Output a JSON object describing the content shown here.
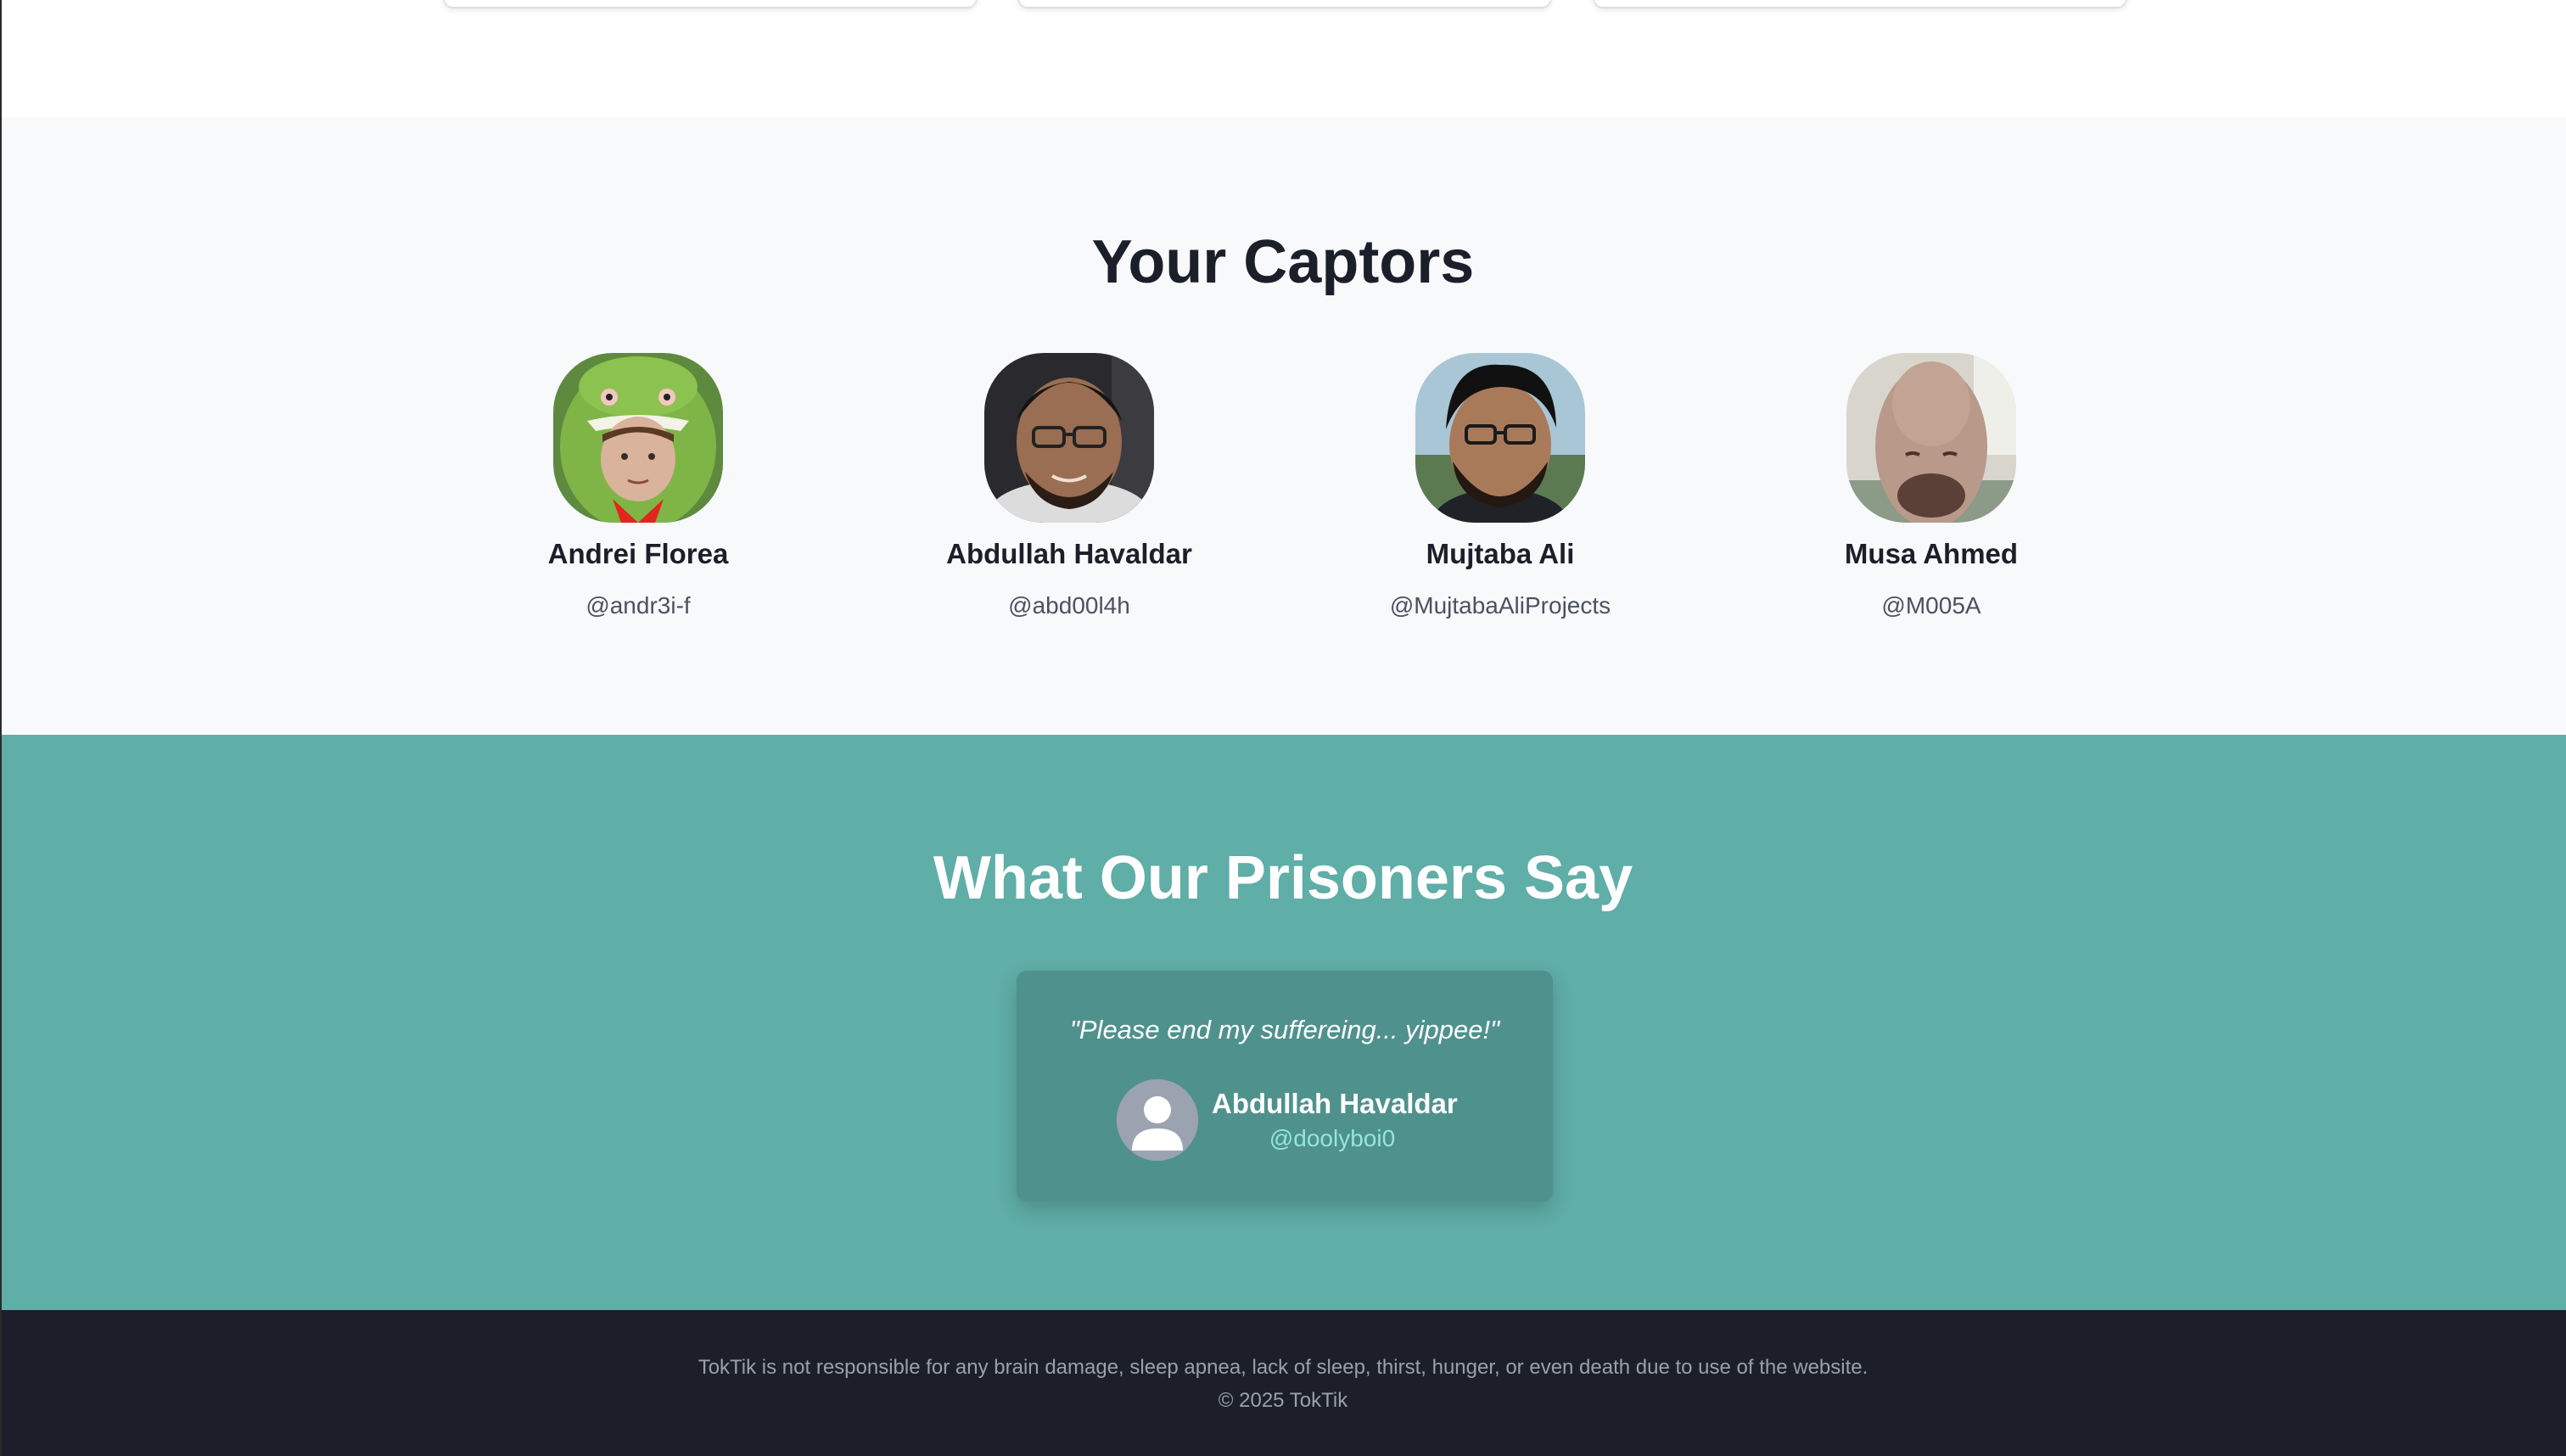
{
  "captors": {
    "title": "Your Captors",
    "people": [
      {
        "name": "Andrei Florea",
        "handle": "@andr3i-f"
      },
      {
        "name": "Abdullah Havaldar",
        "handle": "@abd00l4h"
      },
      {
        "name": "Mujtaba Ali",
        "handle": "@MujtabaAliProjects"
      },
      {
        "name": "Musa Ahmed",
        "handle": "@M005A"
      }
    ]
  },
  "testimonials": {
    "title": "What Our Prisoners Say",
    "items": [
      {
        "quote": "\"Please end my suffereing... yippee!\"",
        "name": "Abdullah Havaldar",
        "handle": "@doolyboi0",
        "avatar_icon": "user-placeholder-icon"
      }
    ]
  },
  "footer": {
    "disclaimer": "TokTik is not responsible for any brain damage, sleep apnea, lack of sleep, thirst, hunger, or even death due to use of the website.",
    "copyright": "© 2025 TokTik"
  },
  "colors": {
    "captors_bg": "#f8f9fb",
    "testimonials_bg": "#5faea7",
    "testimonial_card": "#4f918d",
    "handle_accent": "#93e6da",
    "footer_bg": "#1c1f2a"
  }
}
